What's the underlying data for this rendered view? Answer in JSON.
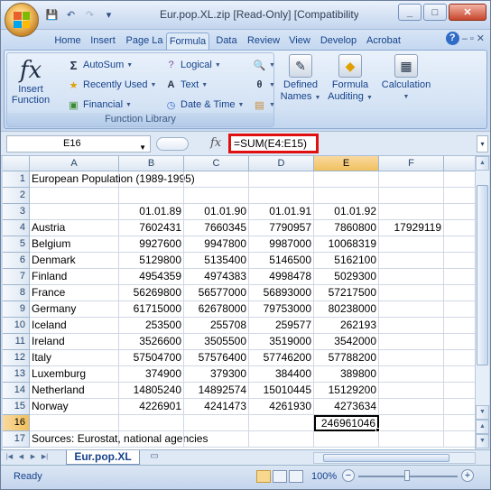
{
  "window": {
    "title": "Eur.pop.XL.zip  [Read-Only]  [Compatibility ...",
    "minimize_label": "_",
    "maximize_label": "□",
    "close_label": "✕"
  },
  "qat": {
    "save_icon": "💾",
    "undo_icon": "↶",
    "redo_icon": "↷",
    "customize_icon": "▾"
  },
  "tabs": [
    {
      "label": "Home"
    },
    {
      "label": "Insert"
    },
    {
      "label": "Page La"
    },
    {
      "label": "Formula"
    },
    {
      "label": "Data"
    },
    {
      "label": "Review"
    },
    {
      "label": "View"
    },
    {
      "label": "Develop"
    },
    {
      "label": "Acrobat"
    }
  ],
  "active_tab": "Formula",
  "help_label": "?",
  "ribbon": {
    "insert_function": {
      "symbol": "fx",
      "line1": "Insert",
      "line2": "Function"
    },
    "autosum": "AutoSum",
    "recently_used": "Recently Used",
    "financial": "Financial",
    "logical": "Logical",
    "text": "Text",
    "date_time": "Date & Time",
    "defined_names": {
      "line1": "Defined",
      "line2": "Names"
    },
    "formula_auditing": {
      "line1": "Formula",
      "line2": "Auditing"
    },
    "calculation": "Calculation",
    "group_label": "Function Library"
  },
  "formula_bar": {
    "name_box": "E16",
    "fx_label": "fx",
    "formula": "=SUM(E4:E15)"
  },
  "columns": [
    "A",
    "B",
    "C",
    "D",
    "E",
    "F"
  ],
  "selected_column": "E",
  "selected_row": "16",
  "rows": [
    {
      "n": "1",
      "a": "European Population (1989-1995)",
      "b": "",
      "c": "",
      "d": "",
      "e": "",
      "f": ""
    },
    {
      "n": "2",
      "a": "",
      "b": "",
      "c": "",
      "d": "",
      "e": "",
      "f": ""
    },
    {
      "n": "3",
      "a": "",
      "b": "01.01.89",
      "c": "01.01.90",
      "d": "01.01.91",
      "e": "01.01.92",
      "f": ""
    },
    {
      "n": "4",
      "a": "Austria",
      "b": "7602431",
      "c": "7660345",
      "d": "7790957",
      "e": "7860800",
      "f": "17929119"
    },
    {
      "n": "5",
      "a": "Belgium",
      "b": "9927600",
      "c": "9947800",
      "d": "9987000",
      "e": "10068319",
      "f": ""
    },
    {
      "n": "6",
      "a": "Denmark",
      "b": "5129800",
      "c": "5135400",
      "d": "5146500",
      "e": "5162100",
      "f": ""
    },
    {
      "n": "7",
      "a": "Finland",
      "b": "4954359",
      "c": "4974383",
      "d": "4998478",
      "e": "5029300",
      "f": ""
    },
    {
      "n": "8",
      "a": "France",
      "b": "56269800",
      "c": "56577000",
      "d": "56893000",
      "e": "57217500",
      "f": ""
    },
    {
      "n": "9",
      "a": "Germany",
      "b": "61715000",
      "c": "62678000",
      "d": "79753000",
      "e": "80238000",
      "f": ""
    },
    {
      "n": "10",
      "a": "Iceland",
      "b": "253500",
      "c": "255708",
      "d": "259577",
      "e": "262193",
      "f": ""
    },
    {
      "n": "11",
      "a": "Ireland",
      "b": "3526600",
      "c": "3505500",
      "d": "3519000",
      "e": "3542000",
      "f": ""
    },
    {
      "n": "12",
      "a": "Italy",
      "b": "57504700",
      "c": "57576400",
      "d": "57746200",
      "e": "57788200",
      "f": ""
    },
    {
      "n": "13",
      "a": "Luxemburg",
      "b": "374900",
      "c": "379300",
      "d": "384400",
      "e": "389800",
      "f": ""
    },
    {
      "n": "14",
      "a": "Netherland",
      "b": "14805240",
      "c": "14892574",
      "d": "15010445",
      "e": "15129200",
      "f": ""
    },
    {
      "n": "15",
      "a": "Norway",
      "b": "4226901",
      "c": "4241473",
      "d": "4261930",
      "e": "4273634",
      "f": ""
    },
    {
      "n": "16",
      "a": "",
      "b": "",
      "c": "",
      "d": "",
      "e": "246961046",
      "f": ""
    },
    {
      "n": "17",
      "a": "Sources: Eurostat, national agencies",
      "b": "",
      "c": "",
      "d": "",
      "e": "",
      "f": ""
    }
  ],
  "sheet_tab": "Eur.pop.XL",
  "status": {
    "ready": "Ready",
    "zoom": "100%",
    "zoom_minus": "−",
    "zoom_plus": "+"
  }
}
